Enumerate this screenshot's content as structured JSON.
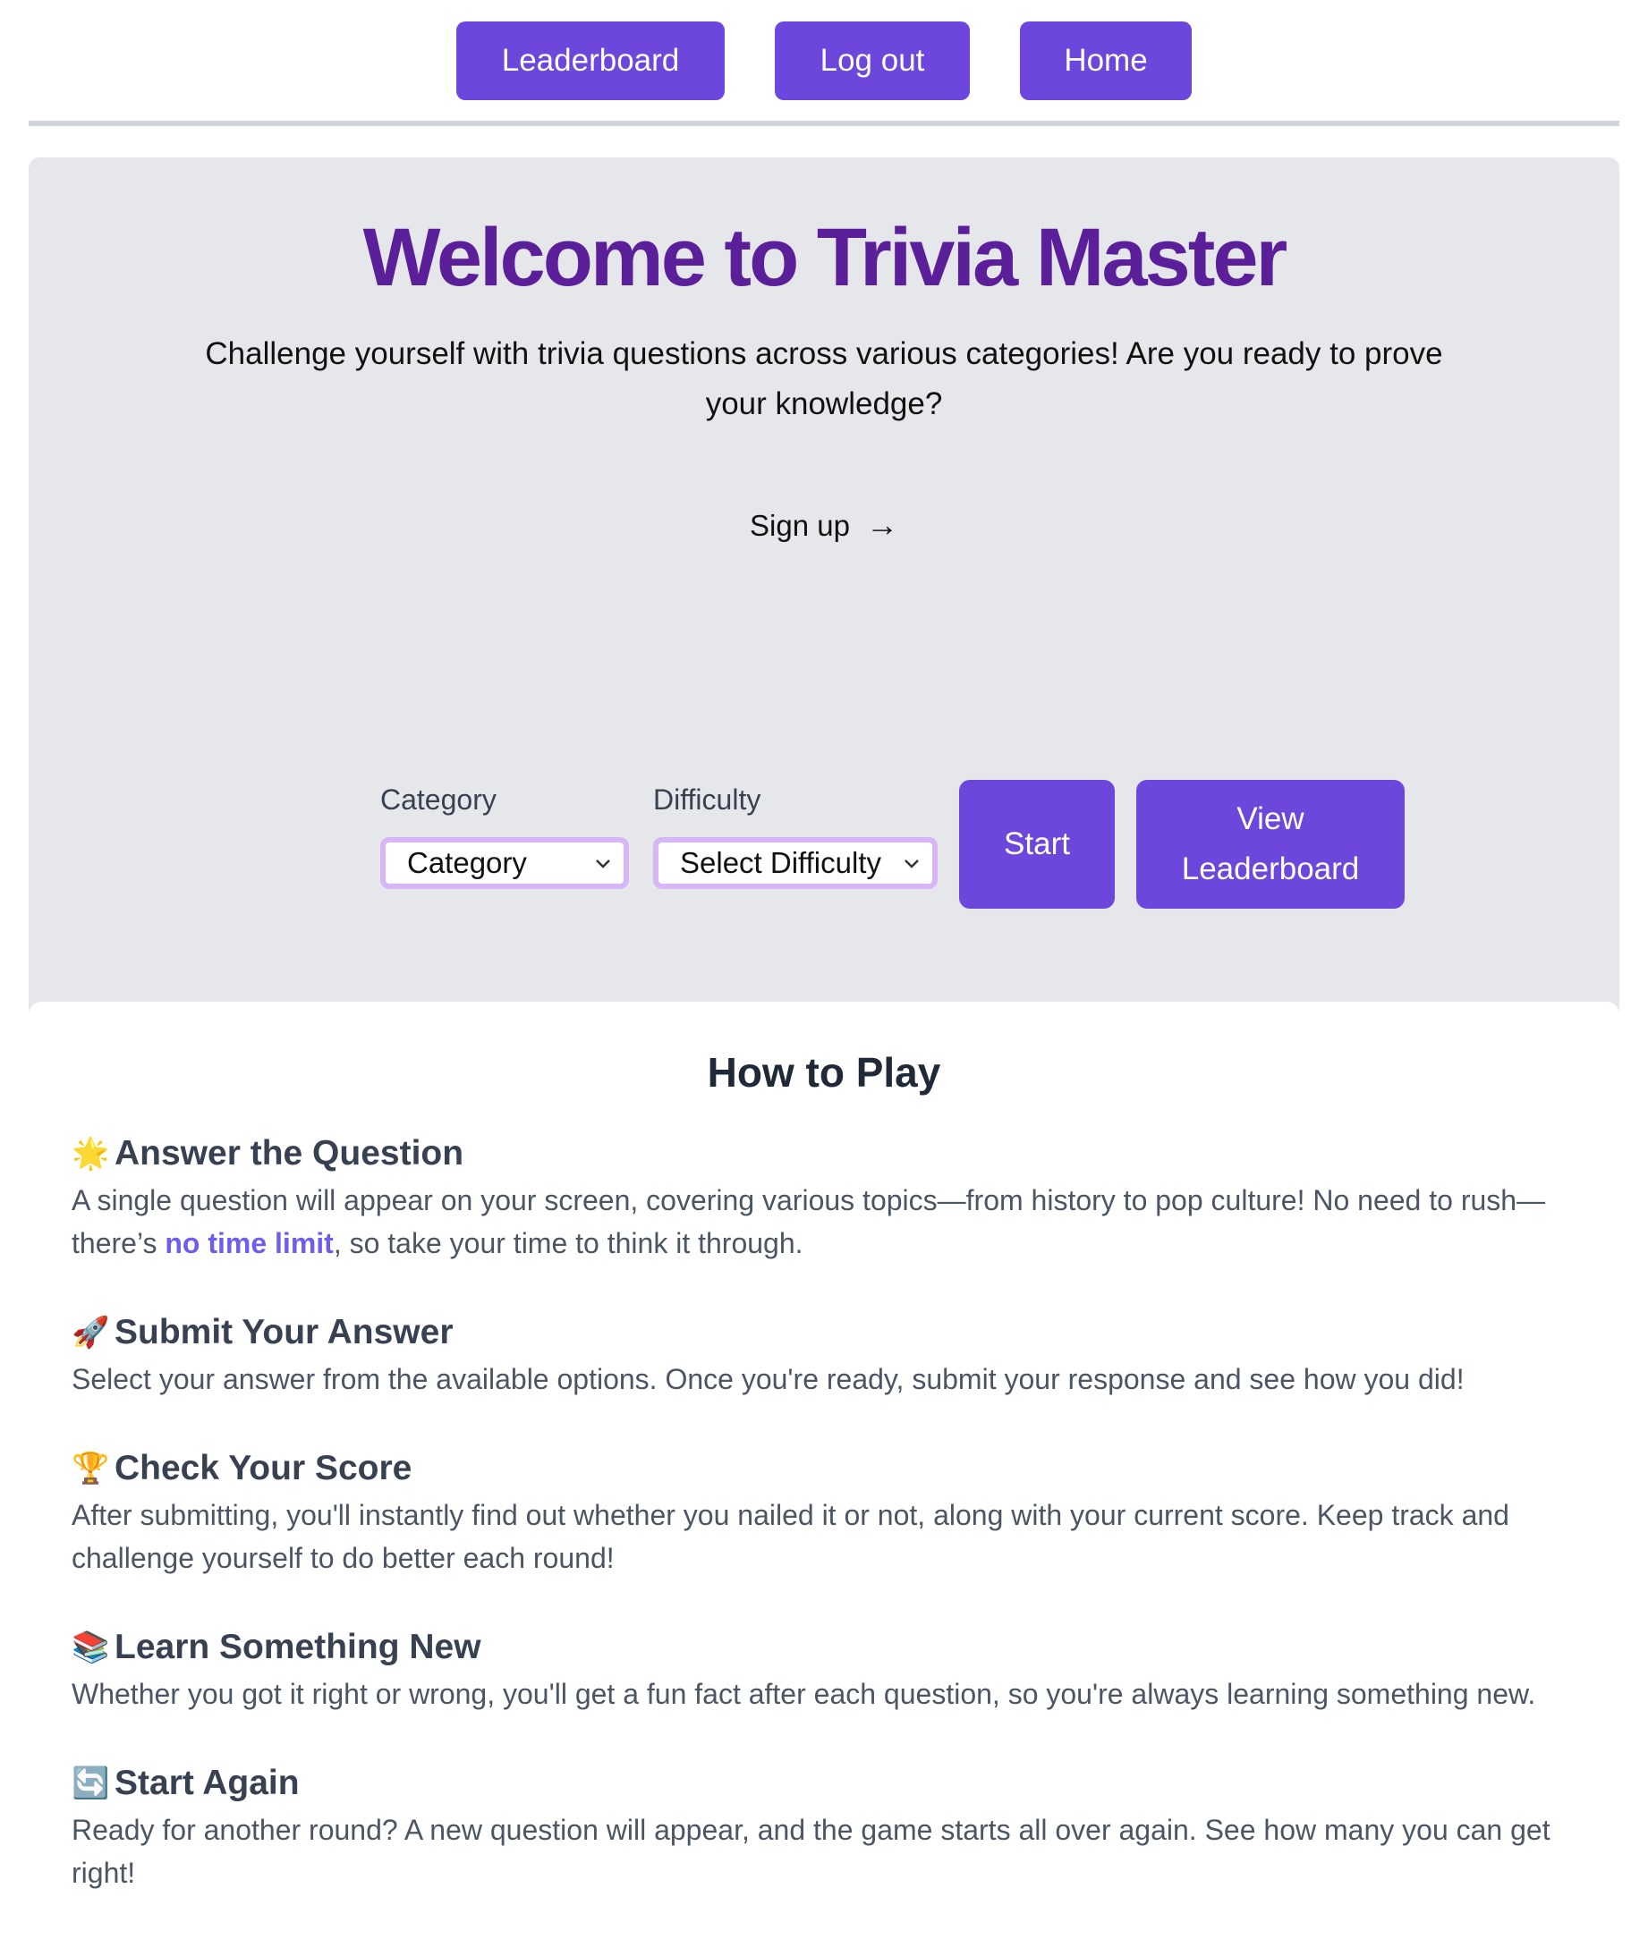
{
  "nav": {
    "leaderboard": "Leaderboard",
    "logout": "Log out",
    "home": "Home"
  },
  "hero": {
    "title": "Welcome to Trivia Master",
    "subtitle": "Challenge yourself with trivia questions across various categories! Are you ready to prove your knowledge?",
    "signup": "Sign up",
    "signup_arrow": "→"
  },
  "controls": {
    "category_label": "Category",
    "category_value": "Category",
    "difficulty_label": "Difficulty",
    "difficulty_value": "Select Difficulty",
    "start": "Start",
    "view_leaderboard_line1": "View",
    "view_leaderboard_line2": "Leaderboard"
  },
  "howto": {
    "title": "How to Play",
    "steps": [
      {
        "icon": "star-icon",
        "glyph": "🌟",
        "heading": "Answer the Question",
        "text_before": "A single question will appear on your screen, covering various topics—from history to pop culture! No need to rush—there’s ",
        "highlight": "no time limit",
        "text_after": ", so take your time to think it through."
      },
      {
        "icon": "rocket-icon",
        "glyph": "🚀",
        "heading": "Submit Your Answer",
        "text": "Select your answer from the available options. Once you're ready, submit your response and see how you did!"
      },
      {
        "icon": "trophy-icon",
        "glyph": "🏆",
        "heading": "Check Your Score",
        "text": "After submitting, you'll instantly find out whether you nailed it or not, along with your current score. Keep track and challenge yourself to do better each round!"
      },
      {
        "icon": "books-icon",
        "glyph": "📚",
        "heading": "Learn Something New",
        "text": "Whether you got it right or wrong, you'll get a fun fact after each question, so you're always learning something new."
      },
      {
        "icon": "restart-icon",
        "glyph": "🔄",
        "heading": "Start Again",
        "text": "Ready for another round? A new question will appear, and the game starts all over again. See how many you can get right!"
      }
    ]
  },
  "colors": {
    "accent": "#6d47dc",
    "title": "#5b1f9a",
    "hero_bg": "#e5e7eb",
    "select_border": "#d7b6f7",
    "highlight": "#6d5ef0"
  }
}
